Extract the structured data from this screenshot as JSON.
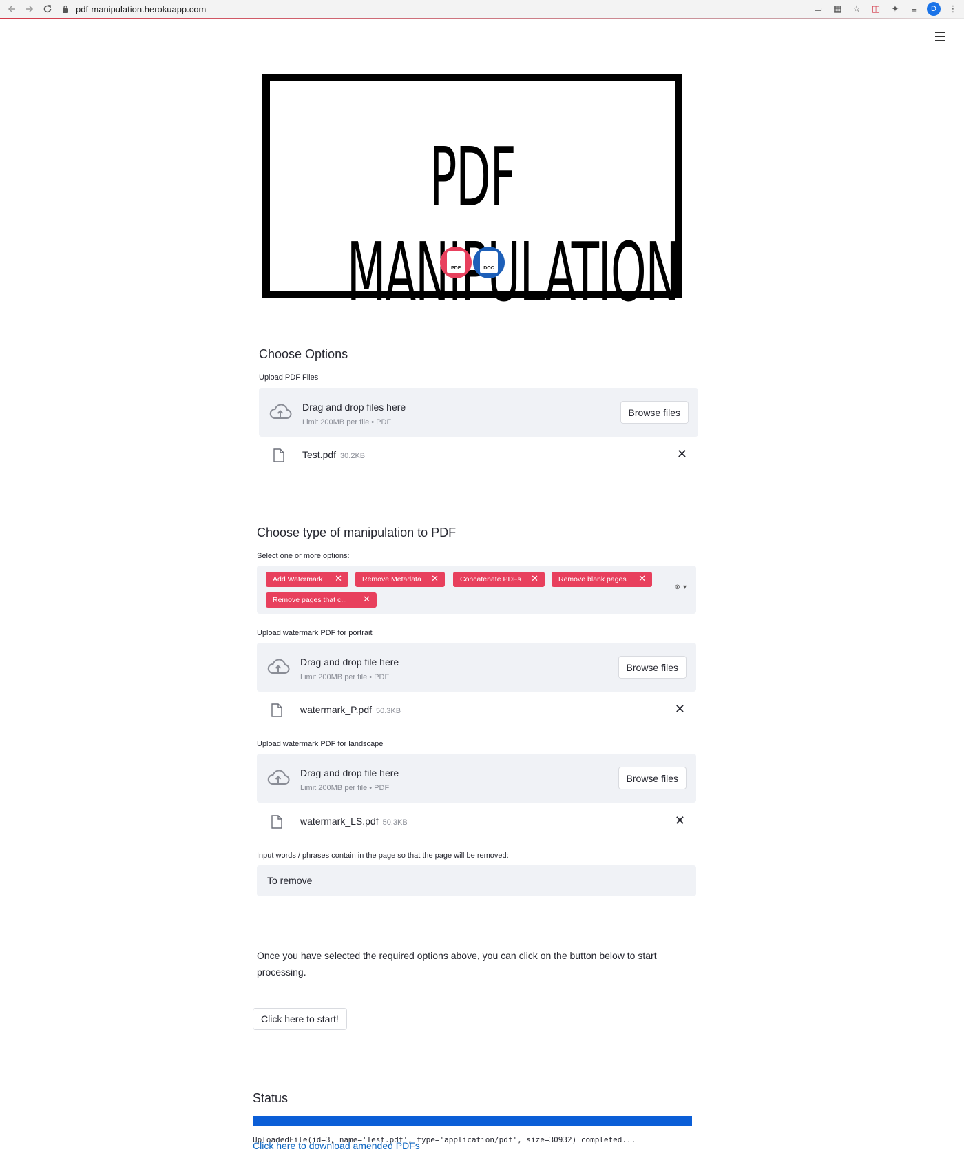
{
  "browser": {
    "url": "pdf-manipulation.herokuapp.com",
    "avatar_initial": "D"
  },
  "logo": {
    "title": "PDF MANIPULATION",
    "badge_pdf": "PDF",
    "badge_doc": "DOC"
  },
  "options": {
    "heading": "Choose Options",
    "upload_label": "Upload PDF Files",
    "dropzone_text": "Drag and drop files here",
    "dropzone_limit": "Limit 200MB per file • PDF",
    "browse_label": "Browse files",
    "file_name": "Test.pdf",
    "file_size": "30.2KB"
  },
  "manipulation": {
    "heading": "Choose type of manipulation to PDF",
    "select_label": "Select one or more options:",
    "tags": [
      "Add Watermark",
      "Remove Metadata",
      "Concatenate PDFs",
      "Remove blank pages",
      "Remove pages that c..."
    ],
    "portrait_label": "Upload watermark PDF for portrait",
    "portrait_dropzone": "Drag and drop file here",
    "portrait_limit": "Limit 200MB per file • PDF",
    "portrait_browse": "Browse files",
    "portrait_file": "watermark_P.pdf",
    "portrait_size": "50.3KB",
    "landscape_label": "Upload watermark PDF for landscape",
    "landscape_dropzone": "Drag and drop file here",
    "landscape_limit": "Limit 200MB per file • PDF",
    "landscape_browse": "Browse files",
    "landscape_file": "watermark_LS.pdf",
    "landscape_size": "50.3KB",
    "words_label": "Input words / phrases contain in the page so that the page will be removed:",
    "words_value": "To remove"
  },
  "process": {
    "instruction": "Once you have selected the required options above, you can click on the button below to start processing.",
    "start_button": "Click here to start!"
  },
  "status": {
    "heading": "Status",
    "progress_percent": 100,
    "log": "UploadedFile(id=3, name='Test.pdf', type='application/pdf', size=30932) completed...",
    "download_link": "Click here to download amended PDFs"
  },
  "colors": {
    "tag": "#e8405d",
    "progress": "#0b5ed7",
    "link": "#0c66c2"
  }
}
